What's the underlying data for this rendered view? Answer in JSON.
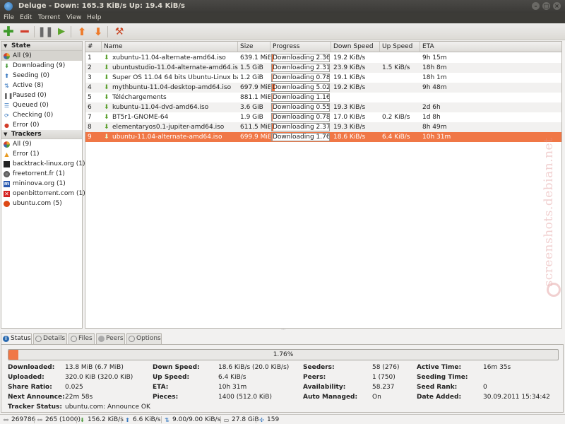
{
  "window": {
    "title": "Deluge - Down: 165.3 KiB/s Up: 19.4 KiB/s"
  },
  "menu": [
    "File",
    "Edit",
    "Torrent",
    "View",
    "Help"
  ],
  "toolbar": {
    "add": "✚",
    "remove": "━",
    "pause": "❚❚",
    "resume": "▶",
    "up": "⬆",
    "down": "⬇",
    "preferences": "⚒"
  },
  "sidebar": {
    "state_header": "State",
    "states": [
      {
        "label": "All (9)",
        "icon": "all-icon"
      },
      {
        "label": "Downloading (9)",
        "icon": "download-icon",
        "glyph": "⬇"
      },
      {
        "label": "Seeding (0)",
        "icon": "seeding-icon",
        "glyph": "⬆"
      },
      {
        "label": "Active (8)",
        "icon": "active-icon",
        "glyph": "⇅"
      },
      {
        "label": "Paused (0)",
        "icon": "paused-icon",
        "glyph": "❚❚"
      },
      {
        "label": "Queued (0)",
        "icon": "queued-icon",
        "glyph": "☰"
      },
      {
        "label": "Checking (0)",
        "icon": "checking-icon",
        "glyph": "⟳"
      },
      {
        "label": "Error (0)",
        "icon": "error-icon",
        "glyph": "●"
      }
    ],
    "trackers_header": "Trackers",
    "trackers": [
      {
        "label": "All (9)",
        "icon": "all-icon"
      },
      {
        "label": "Error (1)",
        "icon": "warning-icon",
        "glyph": "▲"
      },
      {
        "label": "backtrack-linux.org (1)",
        "icon": "tracker-favicon-icon"
      },
      {
        "label": "freetorrent.fr (1)",
        "icon": "tracker-favicon-icon"
      },
      {
        "label": "mininova.org (1)",
        "icon": "tracker-favicon-icon",
        "glyph": "m"
      },
      {
        "label": "openbittorrent.com (1)",
        "icon": "tracker-favicon-icon",
        "glyph": "✕"
      },
      {
        "label": "ubuntu.com (5)",
        "icon": "tracker-favicon-icon"
      }
    ]
  },
  "table": {
    "columns": [
      "#",
      "Name",
      "Size",
      "Progress",
      "Down Speed",
      "Up Speed",
      "ETA"
    ],
    "rows": [
      {
        "num": "1",
        "name": "xubuntu-11.04-alternate-amd64.iso",
        "size": "639.1 MiB",
        "progress_text": "Downloading 2.36%",
        "progress": 0.0236,
        "down": "19.2 KiB/s",
        "up": "",
        "eta": "9h 15m"
      },
      {
        "num": "2",
        "name": "ubuntustudio-11.04-alternate-amd64.iso",
        "size": "1.5 GiB",
        "progress_text": "Downloading 2.31%",
        "progress": 0.0231,
        "down": "23.9 KiB/s",
        "up": "1.5 KiB/s",
        "eta": "18h 8m"
      },
      {
        "num": "3",
        "name": "Super OS 11.04 64 bits Ubuntu-Linux based",
        "size": "1.2 GiB",
        "progress_text": "Downloading 0.78%",
        "progress": 0.0078,
        "down": "19.1 KiB/s",
        "up": "",
        "eta": "18h 1m"
      },
      {
        "num": "4",
        "name": "mythbuntu-11.04-desktop-amd64.iso",
        "size": "697.9 MiB",
        "progress_text": "Downloading 5.02%",
        "progress": 0.0502,
        "down": "19.2 KiB/s",
        "up": "",
        "eta": "9h 48m"
      },
      {
        "num": "5",
        "name": "Téléchargements",
        "size": "881.1 MiB",
        "progress_text": "Downloading 1.16%",
        "progress": 0.0116,
        "down": "",
        "up": "",
        "eta": ""
      },
      {
        "num": "6",
        "name": "kubuntu-11.04-dvd-amd64.iso",
        "size": "3.6 GiB",
        "progress_text": "Downloading 0.55%",
        "progress": 0.0055,
        "down": "19.3 KiB/s",
        "up": "",
        "eta": "2d 6h"
      },
      {
        "num": "7",
        "name": "BT5r1-GNOME-64",
        "size": "1.9 GiB",
        "progress_text": "Downloading 0.78%",
        "progress": 0.0078,
        "down": "17.0 KiB/s",
        "up": "0.2 KiB/s",
        "eta": "1d 8h"
      },
      {
        "num": "8",
        "name": "elementaryos0.1-jupiter-amd64.iso",
        "size": "611.5 MiB",
        "progress_text": "Downloading 2.37%",
        "progress": 0.0237,
        "down": "19.3 KiB/s",
        "up": "",
        "eta": "8h 49m"
      },
      {
        "num": "9",
        "name": "ubuntu-11.04-alternate-amd64.iso",
        "size": "699.9 MiB",
        "progress_text": "Downloading 1.76%",
        "progress": 0.0176,
        "down": "18.6 KiB/s",
        "up": "6.4 KiB/s",
        "eta": "10h 31m",
        "selected": true
      }
    ]
  },
  "tabs": [
    "Status",
    "Details",
    "Files",
    "Peers",
    "Options"
  ],
  "status": {
    "progress_text": "1.76%",
    "progress": 0.0176,
    "col1": [
      {
        "label": "Downloaded:",
        "value": "13.8 MiB (6.7 MiB)"
      },
      {
        "label": "Uploaded:",
        "value": "320.0 KiB (320.0 KiB)"
      },
      {
        "label": "Share Ratio:",
        "value": "0.025"
      },
      {
        "label": "Next Announce:",
        "value": "22m 58s"
      },
      {
        "label": "Tracker Status:",
        "value": "ubuntu.com: Announce OK"
      }
    ],
    "col2": [
      {
        "label": "Down Speed:",
        "value": "18.6 KiB/s (20.0 KiB/s)"
      },
      {
        "label": "Up Speed:",
        "value": "6.4 KiB/s"
      },
      {
        "label": "ETA:",
        "value": "10h 31m"
      },
      {
        "label": "Pieces:",
        "value": "1400 (512.0 KiB)"
      }
    ],
    "col3": [
      {
        "label": "Seeders:",
        "value": "58 (276)"
      },
      {
        "label": "Peers:",
        "value": "1 (750)"
      },
      {
        "label": "Availability:",
        "value": "58.237"
      },
      {
        "label": "Auto Managed:",
        "value": "On"
      }
    ],
    "col4": [
      {
        "label": "Active Time:",
        "value": "16m 35s"
      },
      {
        "label": "Seeding Time:",
        "value": ""
      },
      {
        "label": "Seed Rank:",
        "value": "0"
      },
      {
        "label": "Date Added:",
        "value": "30.09.2011 15:34:42"
      }
    ]
  },
  "statusbar": [
    {
      "value": "269786",
      "icon": "connections-icon",
      "glyph": "⚯"
    },
    {
      "value": "265 (1000)",
      "icon": "dht-icon",
      "glyph": "⚯"
    },
    {
      "value": "156.2 KiB/s",
      "icon": "download-speed-icon",
      "glyph": "⬇"
    },
    {
      "value": "6.6 KiB/s",
      "icon": "upload-speed-icon",
      "glyph": "⬆"
    },
    {
      "value": "9.00/9.00 KiB/s",
      "icon": "protocol-traffic-icon",
      "glyph": "⇅"
    },
    {
      "value": "27.8 GiB",
      "icon": "disk-space-icon",
      "glyph": "▭"
    },
    {
      "value": "159",
      "icon": "dht-nodes-icon",
      "glyph": "✣"
    }
  ],
  "watermark": "screenshots.debian.net"
}
